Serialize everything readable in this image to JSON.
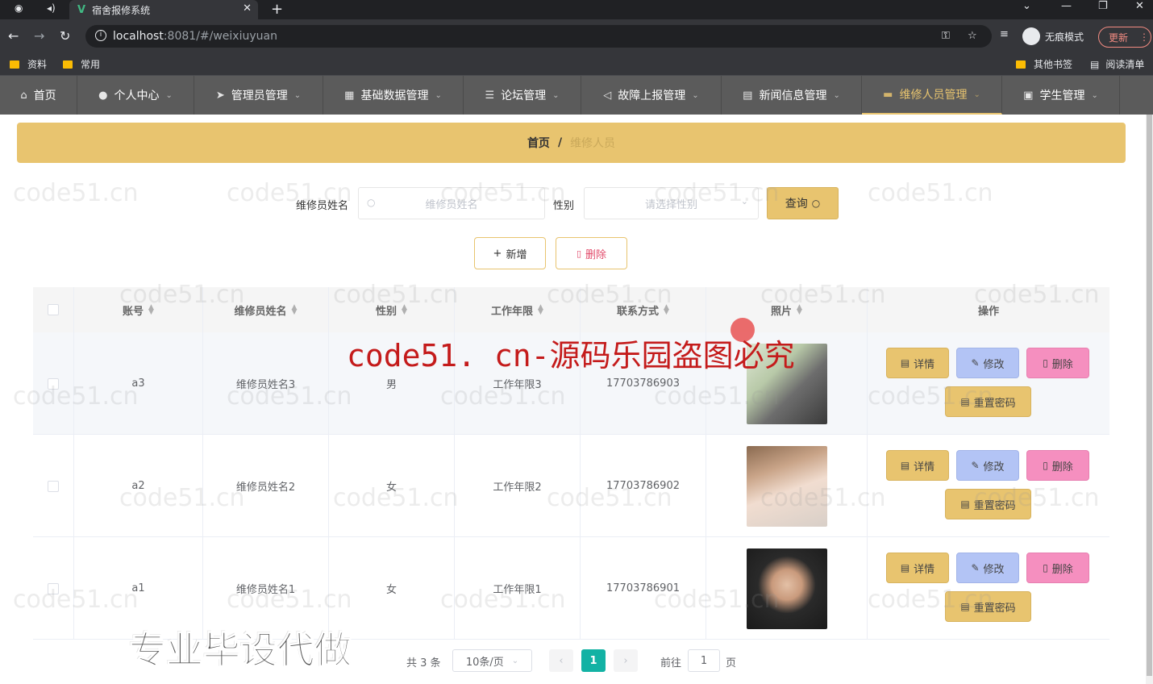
{
  "browser": {
    "tab_title": "宿舍报修系统",
    "url_host": "localhost",
    "url_path": ":8081/#/weixiuyuan",
    "incognito_label": "无痕模式",
    "update_label": "更新",
    "bookmarks": [
      "资料",
      "常用"
    ],
    "bookmarks_right": [
      "其他书签",
      "阅读清单"
    ]
  },
  "nav": {
    "items": [
      {
        "label": "首页",
        "icon": "home-icon"
      },
      {
        "label": "个人中心",
        "icon": "user-icon"
      },
      {
        "label": "管理员管理",
        "icon": "send-icon"
      },
      {
        "label": "基础数据管理",
        "icon": "data-icon"
      },
      {
        "label": "论坛管理",
        "icon": "sliders-icon"
      },
      {
        "label": "故障上报管理",
        "icon": "location-icon"
      },
      {
        "label": "新闻信息管理",
        "icon": "news-icon"
      },
      {
        "label": "维修人员管理",
        "icon": "worker-icon"
      },
      {
        "label": "学生管理",
        "icon": "student-icon"
      }
    ],
    "active_index": 7
  },
  "breadcrumb": {
    "home": "首页",
    "separator": "/",
    "current": "维修人员"
  },
  "search": {
    "name_label": "维修员姓名",
    "name_placeholder": "维修员姓名",
    "gender_label": "性别",
    "gender_placeholder": "请选择性别",
    "query_label": "查询"
  },
  "actions": {
    "add_label": "新增",
    "delete_label": "删除"
  },
  "table": {
    "headers": [
      "账号",
      "维修员姓名",
      "性别",
      "工作年限",
      "联系方式",
      "照片",
      "操作"
    ],
    "rows": [
      {
        "account": "a3",
        "name": "维修员姓名3",
        "gender": "男",
        "years": "工作年限3",
        "phone": "17703786903"
      },
      {
        "account": "a2",
        "name": "维修员姓名2",
        "gender": "女",
        "years": "工作年限2",
        "phone": "17703786902"
      },
      {
        "account": "a1",
        "name": "维修员姓名1",
        "gender": "女",
        "years": "工作年限1",
        "phone": "17703786901"
      }
    ],
    "row_buttons": {
      "detail": "详情",
      "edit": "修改",
      "delete": "删除",
      "reset": "重置密码"
    }
  },
  "pagination": {
    "total": "共 3 条",
    "page_size": "10条/页",
    "current_page": "1",
    "goto_label": "前往",
    "goto_value": "1",
    "page_suffix": "页"
  },
  "watermarks": {
    "site": "code51.cn",
    "red": "code51. cn-源码乐园盗图必究",
    "black": "专业毕设代做"
  },
  "colors": {
    "accent": "#e8c46f",
    "nav_bg": "#5b5b5b",
    "edit": "#b3c4f5",
    "delete": "#f58fbf",
    "pager_active": "#13b2a4"
  }
}
